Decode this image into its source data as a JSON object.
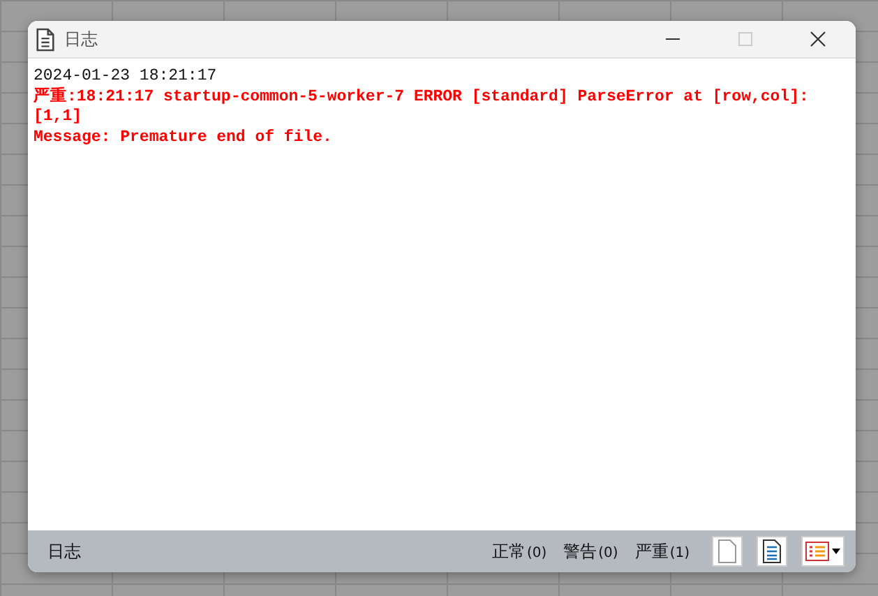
{
  "window": {
    "title": "日志",
    "maximize_disabled": true
  },
  "log": [
    {
      "kind": "plain",
      "text": "2024-01-23 18:21:17"
    },
    {
      "kind": "error",
      "text": "严重:18:21:17 startup-common-5-worker-7 ERROR [standard] ParseError at [row,col]: [1,1]"
    },
    {
      "kind": "error",
      "text": "Message: Premature end of file."
    }
  ],
  "status_bar": {
    "label": "日志",
    "counts": [
      {
        "label": "正常",
        "count": "(0)"
      },
      {
        "label": "警告",
        "count": "(0)"
      },
      {
        "label": "严重",
        "count": "(1)"
      }
    ]
  }
}
